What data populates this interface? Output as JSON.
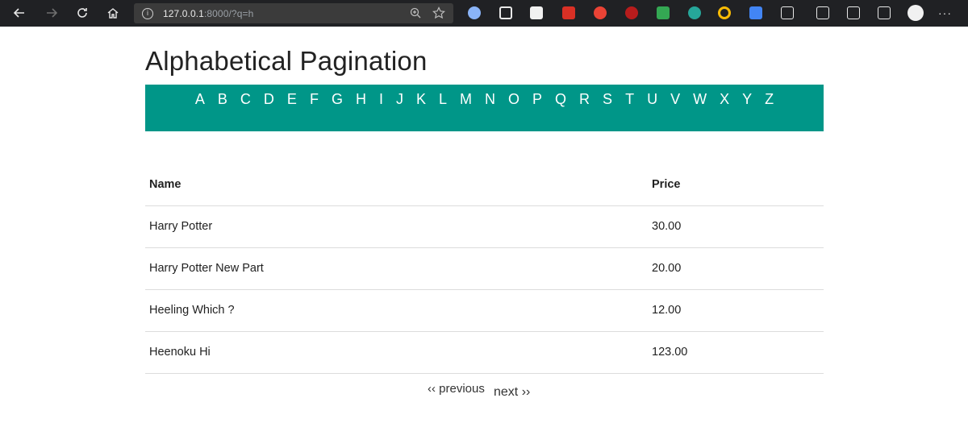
{
  "browser": {
    "url_host": "127.0.0.1",
    "url_rest": ":8000/?q=h",
    "more_label": "···"
  },
  "page": {
    "title": "Alphabetical Pagination",
    "letters": [
      "A",
      "B",
      "C",
      "D",
      "E",
      "F",
      "G",
      "H",
      "I",
      "J",
      "K",
      "L",
      "M",
      "N",
      "O",
      "P",
      "Q",
      "R",
      "S",
      "T",
      "U",
      "V",
      "W",
      "X",
      "Y",
      "Z"
    ],
    "accent_color": "#009688",
    "table": {
      "headers": {
        "name": "Name",
        "price": "Price"
      },
      "rows": [
        {
          "name": "Harry Potter",
          "price": "30.00"
        },
        {
          "name": "Harry Potter New Part",
          "price": "20.00"
        },
        {
          "name": "Heeling Which ?",
          "price": "12.00"
        },
        {
          "name": "Heenoku Hi",
          "price": "123.00"
        }
      ]
    },
    "pager": {
      "previous": "‹‹ previous",
      "next": "next ››"
    }
  }
}
